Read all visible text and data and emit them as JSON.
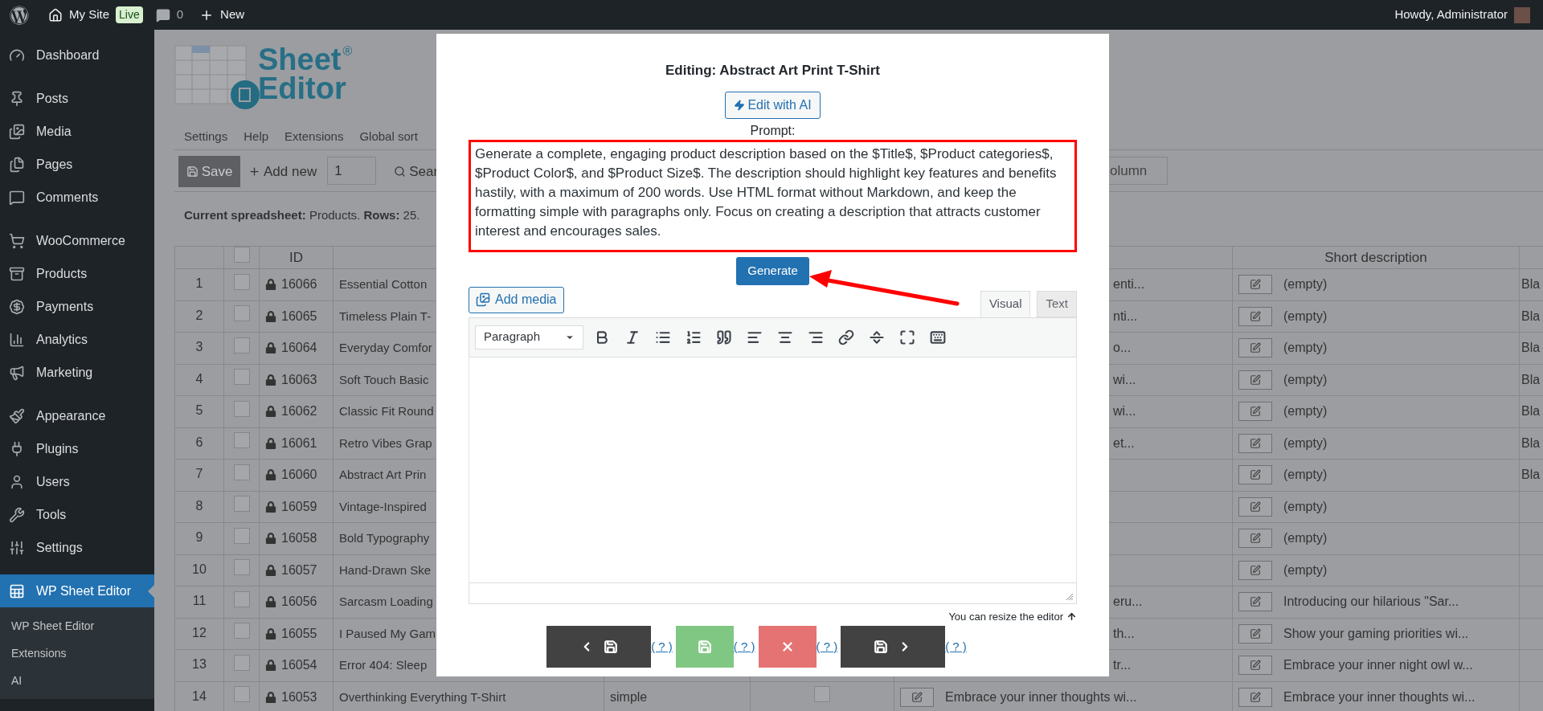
{
  "admin_bar": {
    "site": "My Site",
    "badge": "Live",
    "comments": "0",
    "new": "New",
    "greeting": "Howdy, Administrator"
  },
  "sidebar": {
    "groups": [
      [
        {
          "label": "Dashboard",
          "selected": false
        }
      ],
      [
        {
          "label": "Posts",
          "selected": false
        },
        {
          "label": "Media",
          "selected": false
        },
        {
          "label": "Pages",
          "selected": false
        },
        {
          "label": "Comments",
          "selected": false
        }
      ],
      [
        {
          "label": "WooCommerce",
          "selected": false
        },
        {
          "label": "Products",
          "selected": false
        },
        {
          "label": "Payments",
          "selected": false
        },
        {
          "label": "Analytics",
          "selected": false
        },
        {
          "label": "Marketing",
          "selected": false
        }
      ],
      [
        {
          "label": "Appearance",
          "selected": false
        },
        {
          "label": "Plugins",
          "selected": false
        },
        {
          "label": "Users",
          "selected": false
        },
        {
          "label": "Tools",
          "selected": false
        },
        {
          "label": "Settings",
          "selected": false
        }
      ],
      [
        {
          "label": "WP Sheet Editor",
          "selected": true,
          "children": [
            {
              "label": "WP Sheet Editor"
            },
            {
              "label": "Extensions"
            },
            {
              "label": "AI"
            }
          ]
        }
      ]
    ]
  },
  "logo": {
    "line1": "Sheet",
    "mark": "®",
    "line2": "Editor"
  },
  "menu": [
    "Settings",
    "Help",
    "Extensions",
    "Global sort"
  ],
  "toolbar": {
    "save": "Save",
    "add_new": "Add new",
    "count": "1",
    "search": "Sear",
    "column_field": "olumn"
  },
  "summary": "**Current spreadsheet:** Products. **Rows:** 25.",
  "table": {
    "columns": {
      "id": "ID",
      "short_description": "Short description"
    },
    "header_checked": false,
    "rows": [
      {
        "number": "1",
        "checked": false,
        "id": "16066",
        "title": "Essential Cotton",
        "description": "enti...",
        "short_description": "(empty)",
        "column_9": "Bla"
      },
      {
        "number": "2",
        "checked": false,
        "id": "16065",
        "title": "Timeless Plain T-",
        "description": "nti...",
        "short_description": "(empty)",
        "column_9": "Bla"
      },
      {
        "number": "3",
        "checked": false,
        "id": "16064",
        "title": "Everyday Comfor",
        "description": "o...",
        "short_description": "(empty)",
        "column_9": "Bla"
      },
      {
        "number": "4",
        "checked": false,
        "id": "16063",
        "title": "Soft Touch Basic",
        "description": "wi...",
        "short_description": "(empty)",
        "column_9": "Bla"
      },
      {
        "number": "5",
        "checked": false,
        "id": "16062",
        "title": "Classic Fit Round",
        "description": "wi...",
        "short_description": "(empty)",
        "column_9": "Bla"
      },
      {
        "number": "6",
        "checked": false,
        "id": "16061",
        "title": "Retro Vibes Grap",
        "description": "et...",
        "short_description": "(empty)",
        "column_9": "Bla"
      },
      {
        "number": "7",
        "checked": false,
        "id": "16060",
        "title": "Abstract Art Prin",
        "short_description": "(empty)",
        "column_9": "Bla"
      },
      {
        "number": "8",
        "checked": false,
        "id": "16059",
        "title": "Vintage-Inspired",
        "short_description": "(empty)"
      },
      {
        "number": "9",
        "checked": false,
        "id": "16058",
        "title": "Bold Typography",
        "short_description": "(empty)"
      },
      {
        "number": "10",
        "checked": false,
        "id": "16057",
        "title": "Hand-Drawn Ske",
        "short_description": "(empty)"
      },
      {
        "number": "11",
        "checked": false,
        "id": "16056",
        "title": "Sarcasm Loading",
        "description": "eru...",
        "short_description": "Introducing our hilarious \"Sar..."
      },
      {
        "number": "12",
        "checked": false,
        "id": "16055",
        "title": "I Paused My Gam",
        "description": "th...",
        "short_description": "Show your gaming priorities wi..."
      },
      {
        "number": "13",
        "checked": false,
        "id": "16054",
        "title": "Error 404: Sleep",
        "description": "tr...",
        "short_description": "Embrace your inner night owl w..."
      },
      {
        "number": "14",
        "checked": false,
        "id": "16053",
        "title": "Overthinking Everything T-Shirt",
        "column_5": "simple",
        "column_6_checked": false,
        "description": "Embrace your inner thoughts wi...",
        "short_description": "Embrace your inner thoughts wi..."
      }
    ]
  },
  "modal": {
    "title": "Editing: Abstract Art Print T-Shirt",
    "ai_button": "Edit with AI",
    "prompt_label": "Prompt:",
    "prompt": "Generate a complete, engaging product description based on the $Title$, $Product categories$, $Product Color$, and $Product Size$. The description should highlight key features and benefits hastily, with a maximum of 200 words. Use HTML format without Markdown, and keep the formatting simple with paragraphs only. Focus on creating a description that attracts customer interest and encourages sales.",
    "prompt_highlighted": true,
    "generate": "Generate",
    "add_media": "Add media",
    "tabs": [
      {
        "label": "Visual",
        "selected": true
      },
      {
        "label": "Text",
        "selected": false
      }
    ],
    "format": "Paragraph",
    "resize_hint": "You can resize the editor",
    "actions": [
      {
        "kind": "prev_save",
        "help": "( ? )"
      },
      {
        "kind": "save",
        "help": "( ? )"
      },
      {
        "kind": "close",
        "help": "( ? )"
      },
      {
        "kind": "save_next",
        "help": "( ? )"
      }
    ]
  }
}
